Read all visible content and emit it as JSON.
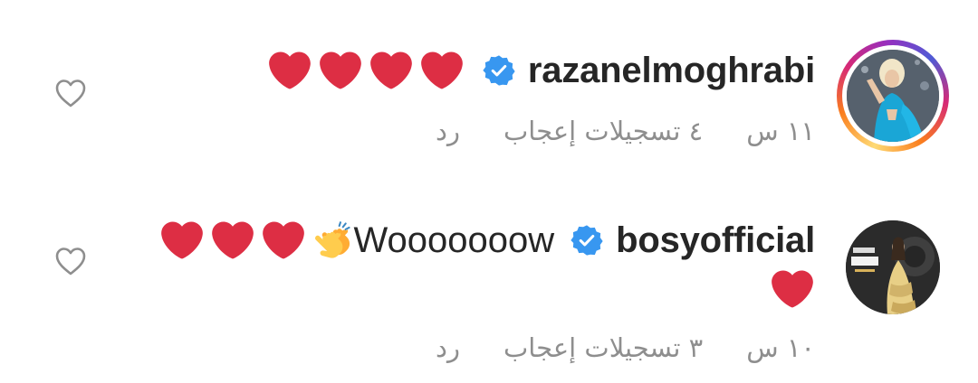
{
  "comments": [
    {
      "username": "razanelmoghrabi",
      "verified": true,
      "text": "",
      "emoji_line1": [
        "red-heart",
        "red-heart",
        "red-heart",
        "red-heart"
      ],
      "emoji_line2": [],
      "time": "١١ س",
      "likes": "٤ تسجيلات إعجاب",
      "reply": "رد",
      "avatar_story_ring": true
    },
    {
      "username": "bosyofficial",
      "verified": true,
      "text": "Wooooooow",
      "emoji_line1": [
        "red-heart",
        "red-heart",
        "red-heart",
        "clapping-hands"
      ],
      "emoji_line2": [
        "red-heart"
      ],
      "time": "١٠ س",
      "likes": "٣ تسجيلات إعجاب",
      "reply": "رد",
      "avatar_story_ring": false
    }
  ],
  "colors": {
    "verified_badge": "#3897f0",
    "meta_text": "#8e8e8e",
    "heart": "#dd2e44",
    "username": "#262626"
  },
  "icons": {
    "like": "heart-outline-icon",
    "verified": "verified-badge-icon"
  }
}
